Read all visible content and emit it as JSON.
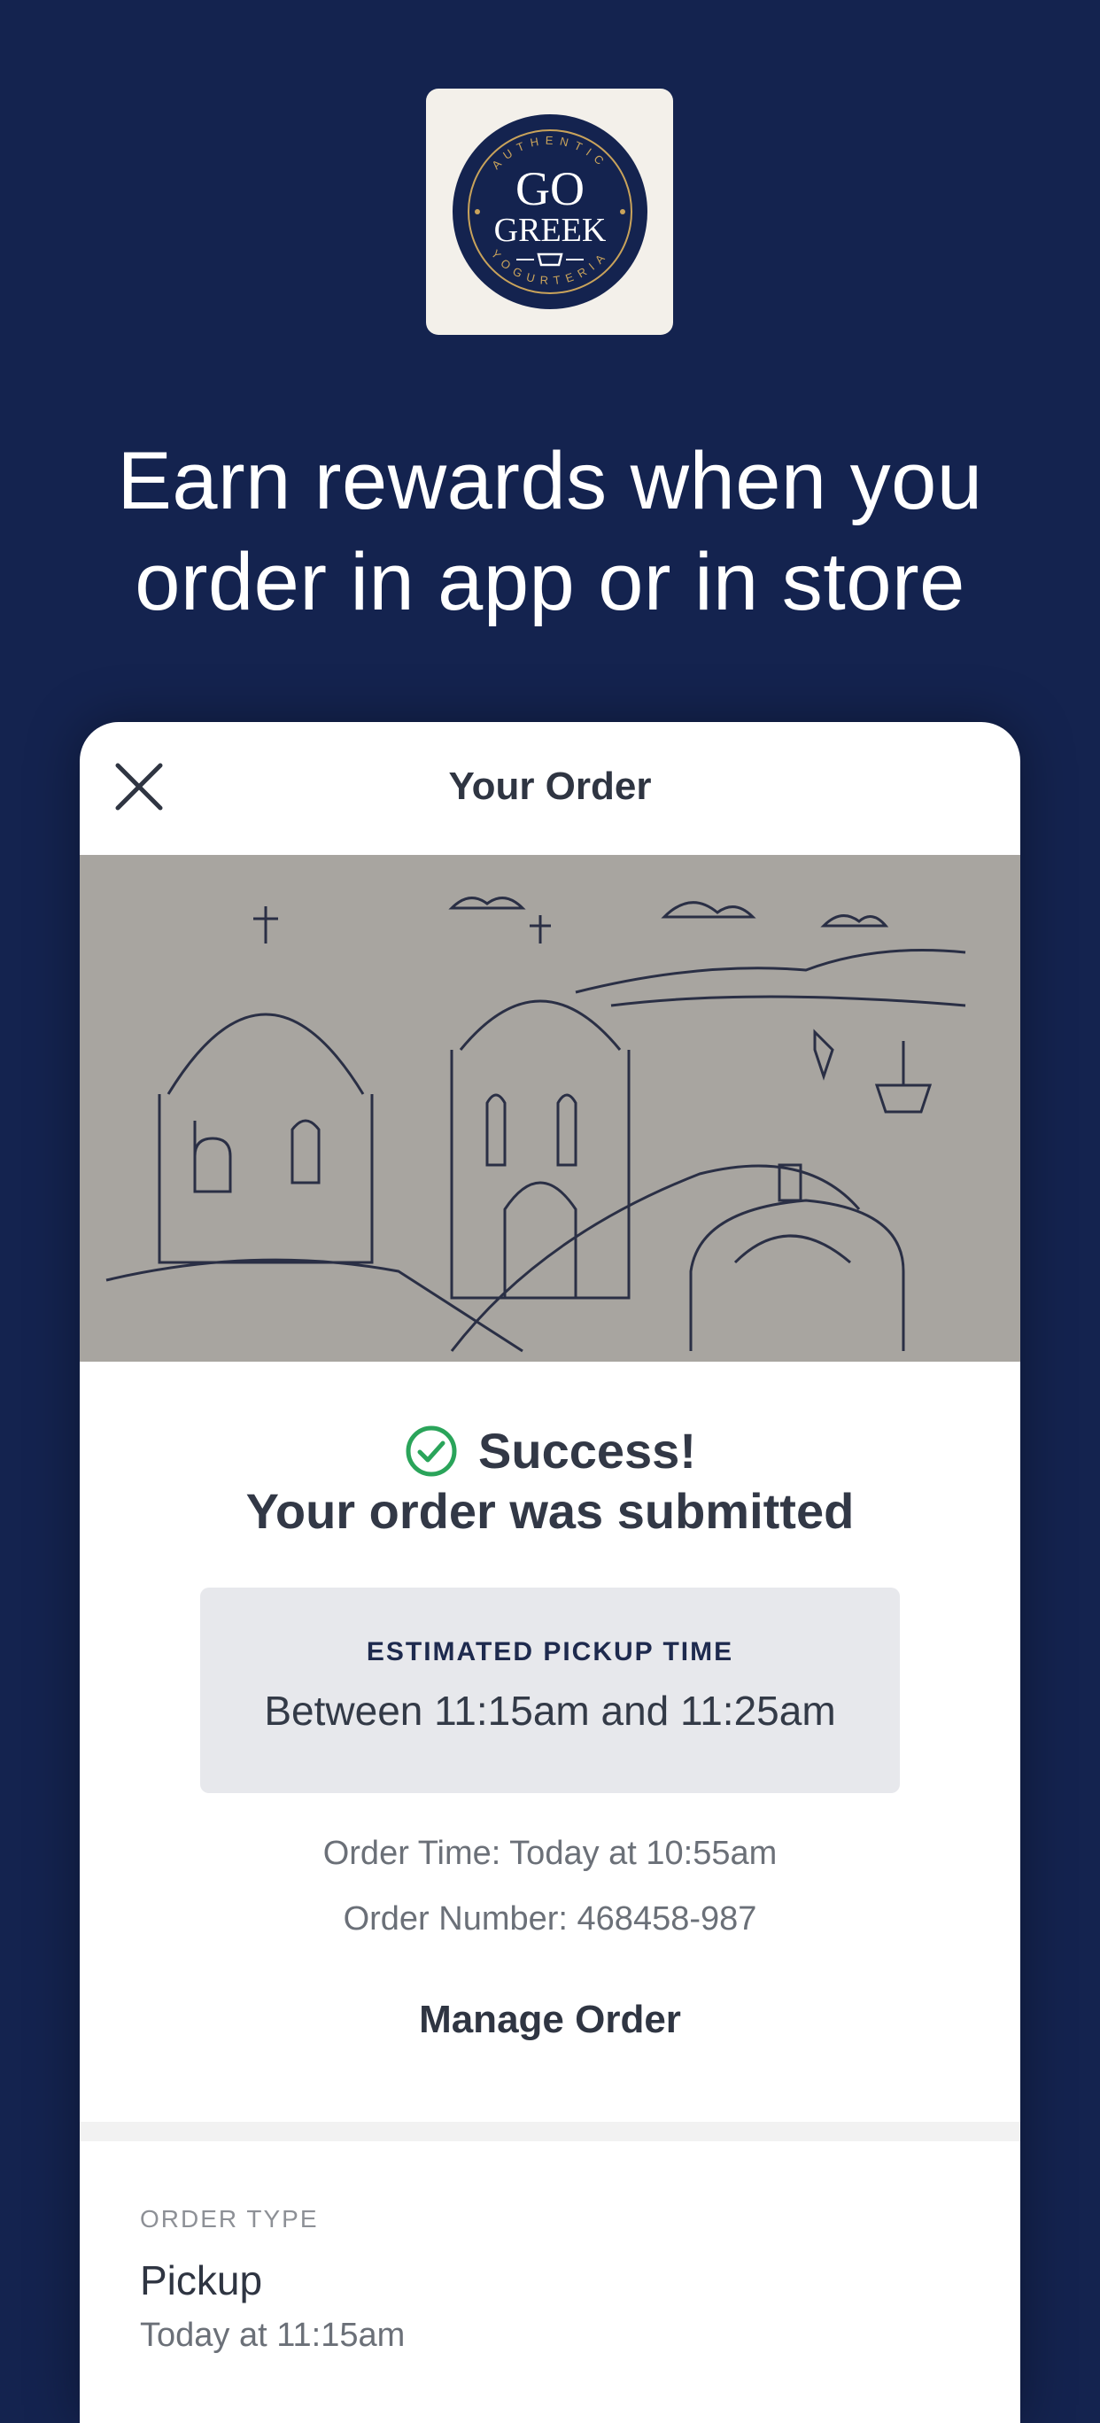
{
  "branding": {
    "logo_line1": "GO",
    "logo_line2": "GREEK",
    "logo_arc_top": "AUTHENTIC",
    "logo_arc_bottom": "YOGURTERIA",
    "colors": {
      "background": "#14234f",
      "gold": "#c9a35b",
      "success": "#2aa45a"
    }
  },
  "headline": "Earn rewards when you order in app or in store",
  "card": {
    "title": "Your Order",
    "close_icon": "close-icon",
    "success_title": "Success!",
    "success_subtitle": "Your order was submitted",
    "pickup": {
      "label": "ESTIMATED PICKUP TIME",
      "value": "Between 11:15am and 11:25am"
    },
    "order_time": "Order Time: Today at 10:55am",
    "order_number": "Order Number: 468458-987",
    "manage_label": "Manage Order",
    "order_type": {
      "label": "ORDER TYPE",
      "value": "Pickup",
      "time": "Today at 11:15am"
    }
  }
}
